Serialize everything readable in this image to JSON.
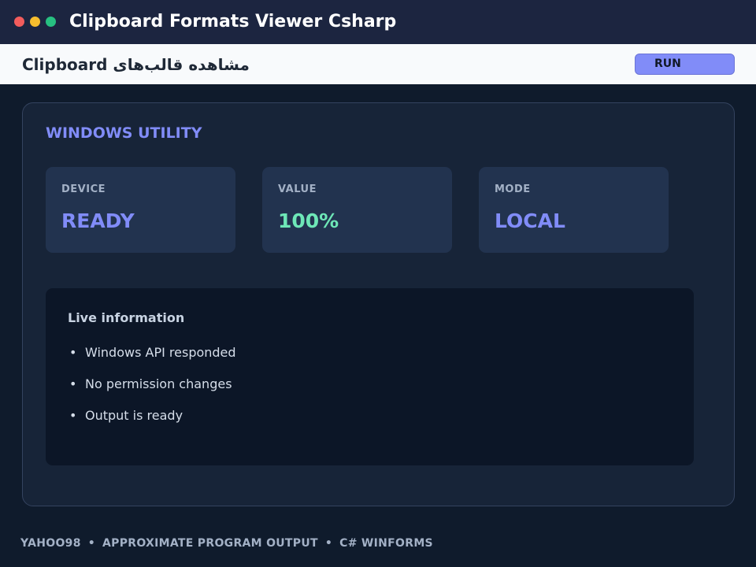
{
  "window": {
    "title": "Clipboard Formats Viewer Csharp",
    "traffic_lights": {
      "close": "#f25c5c",
      "minimize": "#f6bd2e",
      "maximize": "#27c081"
    }
  },
  "header": {
    "title": "Clipboard مشاهده قالب‌های",
    "run_label": "RUN"
  },
  "panel": {
    "section_title": "WINDOWS UTILITY",
    "stats": [
      {
        "label": "DEVICE",
        "value": "READY",
        "color": "#818cf8"
      },
      {
        "label": "VALUE",
        "value": "100%",
        "color": "#6ee7b7"
      },
      {
        "label": "MODE",
        "value": "LOCAL",
        "color": "#818cf8"
      }
    ],
    "info": {
      "title": "Live information",
      "bullet": "•",
      "items": [
        "Windows API responded",
        "No permission changes",
        "Output is ready"
      ]
    }
  },
  "footer": {
    "parts": [
      "YAHOO98",
      "APPROXIMATE PROGRAM OUTPUT",
      "C# WINFORMS"
    ],
    "separator": "•"
  },
  "colors": {
    "background": "#0f1b2c",
    "titlebar": "#1c2540",
    "accent": "#818cf8",
    "success": "#6ee7b7"
  }
}
